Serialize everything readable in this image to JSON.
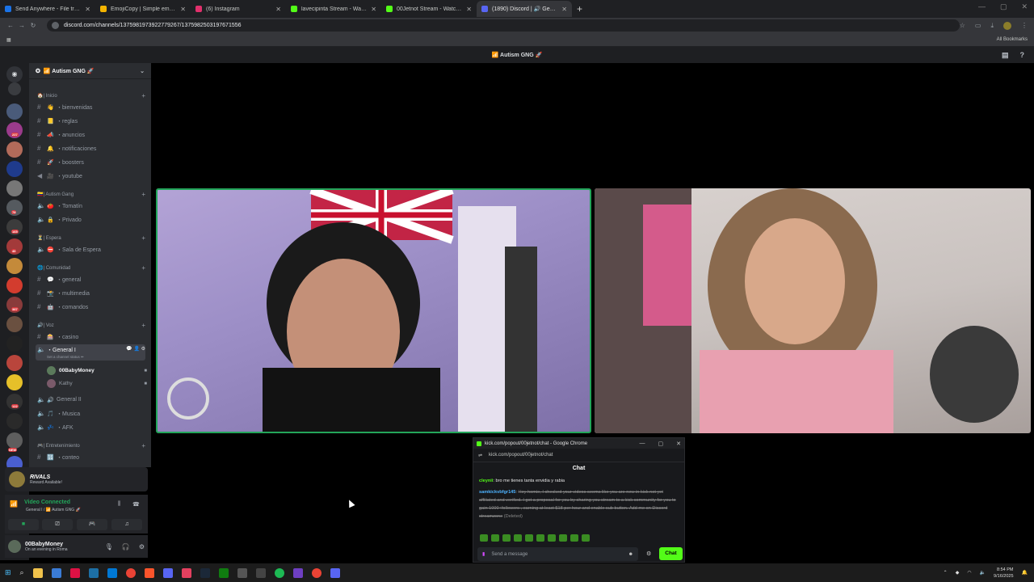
{
  "browser": {
    "tabs": [
      {
        "label": "Send Anywhere - File transfer",
        "color": "#1a73e8"
      },
      {
        "label": "EmojiCopy | Simple emoji copy",
        "color": "#f4b400"
      },
      {
        "label": "(6) Instagram",
        "color": "#e1306c"
      },
      {
        "label": "lavecipinta Stream - Watch Live",
        "color": "#53fc18"
      },
      {
        "label": "00Jetnot Stream - Watch Live o",
        "color": "#53fc18"
      },
      {
        "label": "(1890) Discord | 🔊 General",
        "color": "#5865f2"
      }
    ],
    "url": "discord.com/channels/1375981973922779267/1375982503197671556",
    "bookmarks_label": "All Bookmarks"
  },
  "discord": {
    "title": "📶 Autism GNG 🚀",
    "server_name": "📶 Autism GNG 🚀",
    "categories": [
      {
        "name": "| Inicio",
        "emoji": "🏠"
      },
      {
        "name": "| Autism Gang",
        "emoji": "🇨🇴"
      },
      {
        "name": "| Espera",
        "emoji": "⏳"
      },
      {
        "name": "| Comunidad",
        "emoji": "🌐"
      },
      {
        "name": "| Voz",
        "emoji": "🔊"
      },
      {
        "name": "| Entretenimiento",
        "emoji": "🎮"
      }
    ],
    "channels": [
      {
        "label": "・bienvenidas",
        "emoji": "👋",
        "kind": "#"
      },
      {
        "label": "・reglas",
        "emoji": "📒",
        "kind": "#"
      },
      {
        "label": "・anuncios",
        "emoji": "📣",
        "kind": "#"
      },
      {
        "label": "・notificaciones",
        "emoji": "🔔",
        "kind": "#"
      },
      {
        "label": "・boosters",
        "emoji": "🚀",
        "kind": "#"
      },
      {
        "label": "・youtube",
        "emoji": "🎥",
        "kind": "🔊"
      },
      {
        "label": "・Tomatín",
        "emoji": "🍅",
        "kind": "🔊"
      },
      {
        "label": "・Privado",
        "emoji": "🔒",
        "kind": "🔊"
      },
      {
        "label": "・Sala de Espera",
        "emoji": "⛔",
        "kind": "🔊"
      },
      {
        "label": "・general",
        "emoji": "💬",
        "kind": "#"
      },
      {
        "label": "・multimedia",
        "emoji": "📸",
        "kind": "#"
      },
      {
        "label": "・comandos",
        "emoji": "🤖",
        "kind": "#"
      },
      {
        "label": "・casino",
        "emoji": "🎰",
        "kind": "#"
      },
      {
        "label": "・General I",
        "emoji": "🔊",
        "kind": "🔊"
      },
      {
        "label": "General II",
        "emoji": "🔊",
        "kind": "🔊"
      },
      {
        "label": "・Musica",
        "emoji": "🎵",
        "kind": "🔊"
      },
      {
        "label": "・AFK",
        "emoji": "💤",
        "kind": "🔊"
      },
      {
        "label": "・conteo",
        "emoji": "🔢",
        "kind": "#"
      }
    ],
    "channel_status": "Set a channel status ✏",
    "voice_users": [
      "00BabyMoney",
      "Kathy"
    ],
    "promo": {
      "title": "RIVALS",
      "subtitle": "Reward Available!"
    },
    "voice_panel": {
      "status": "Video Connected",
      "sub": "General I / 📶 Autism GNG 🚀"
    },
    "user": {
      "name": "00BabyMoney",
      "status": "On an evening in Roma"
    },
    "server_badges": [
      "237",
      "78",
      "165",
      "46",
      "387",
      "122",
      "NEW"
    ]
  },
  "kick_popout": {
    "window_title": "kick.com/popout/00jetnot/chat - Google Chrome",
    "url": "kick.com/popout/00jetnot/chat",
    "header": "Chat",
    "messages": [
      {
        "user": "cleynii",
        "text": "bro me tienes tanta envidia y rabia",
        "deleted": false
      },
      {
        "user": "samkickvbfgr145",
        "text": "Hey homie, I checked your videos seems like you are new in kick not yet affiliated and verified. I got a proposal for you by sharing you stream to a kick community for you to gain 1000+followers , earning at least $18 per hour and enable sub button. Add me on Discord streamzone",
        "deleted_tag": "(Deleted)",
        "deleted": true
      }
    ],
    "input_placeholder": "Send a message",
    "chat_button": "Chat"
  },
  "taskbar": {
    "time": "8:54 PM",
    "date": "9/16/2025"
  },
  "colors": {
    "discord_bg": "#2b2d31",
    "speaking_border": "#23a55a",
    "kick_green": "#53fc18"
  }
}
